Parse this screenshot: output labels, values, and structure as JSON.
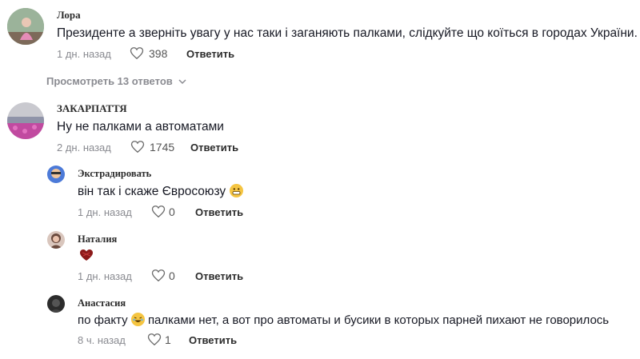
{
  "comments": [
    {
      "author": "Лора",
      "text": "Президенте а зверніть увагу у нас таки і заганяють палками, слідкуйте що коїться в городах України.",
      "time": "1 дн. назад",
      "likes": "398",
      "reply_label": "Ответить",
      "view_replies": "Просмотреть 13 ответов",
      "avatar_color": "#8fa58a"
    },
    {
      "author": "ЗАКАРПАТТЯ",
      "text": "Ну не палками а автоматами",
      "time": "2 дн. назад",
      "likes": "1745",
      "reply_label": "Ответить",
      "avatar_color": "#b24f9c",
      "replies": [
        {
          "author": "Экстрадировать",
          "text_before": "він так і скаже Євросоюзу",
          "time": "1 дн. назад",
          "likes": "0",
          "reply_label": "Ответить",
          "avatar_color": "#6a8fd6"
        },
        {
          "author": "Наталия",
          "time": "1 дн. назад",
          "likes": "0",
          "reply_label": "Ответить",
          "avatar_color": "#a07a6a"
        },
        {
          "author": "Анастасия",
          "text_before": "по факту",
          "text_after": "палками нет, а вот про автоматы и бусики в которых парней пихают не говорилось",
          "time": "8 ч. назад",
          "likes": "1",
          "reply_label": "Ответить",
          "avatar_color": "#3a3a3a"
        }
      ]
    }
  ]
}
